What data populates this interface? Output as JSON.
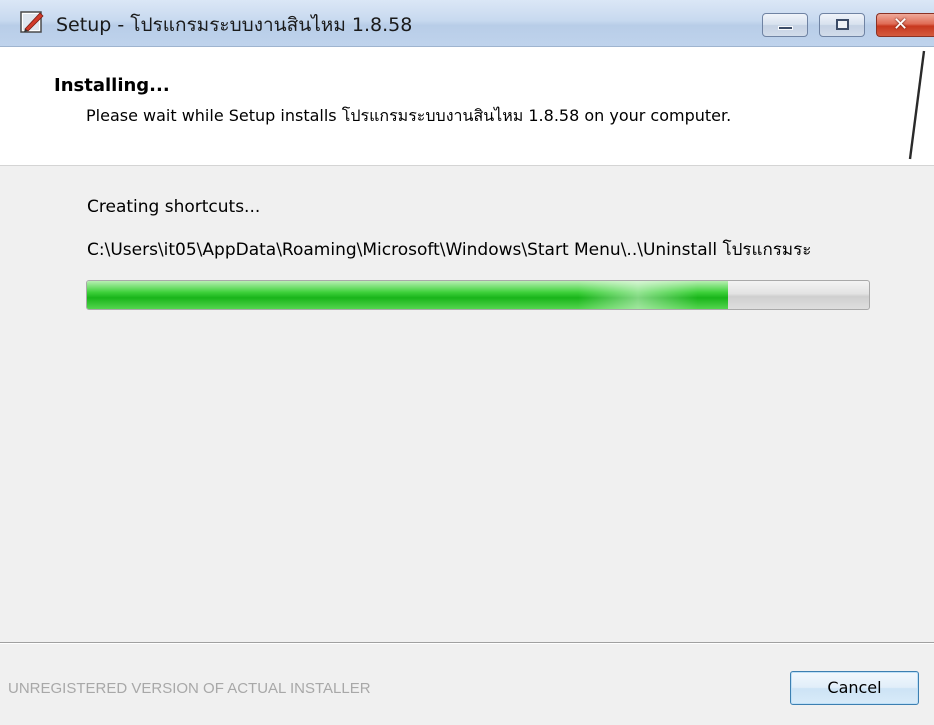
{
  "window": {
    "title": "Setup - โปรแกรมระบบงานสินไหม 1.8.58",
    "icon": "setup-icon",
    "controls": {
      "minimize": "minimize-icon",
      "maximize": "maximize-icon",
      "close": "close-icon",
      "close_glyph": "✕"
    }
  },
  "header": {
    "title": "Installing...",
    "description": "Please wait while Setup installs โปรแกรมระบบงานสินไหม 1.8.58 on your computer."
  },
  "progress": {
    "status": "Creating shortcuts...",
    "current_path": "C:\\Users\\it05\\AppData\\Roaming\\Microsoft\\Windows\\Start Menu\\..\\Uninstall โปรแกรมระ",
    "fraction": 0.82
  },
  "footer": {
    "brand": "UNREGISTERED VERSION OF ACTUAL INSTALLER",
    "cancel_label": "Cancel"
  },
  "colors": {
    "progress_green": "#19b51a",
    "close_red": "#c7381f",
    "brand_gray": "#a8a8a8"
  }
}
